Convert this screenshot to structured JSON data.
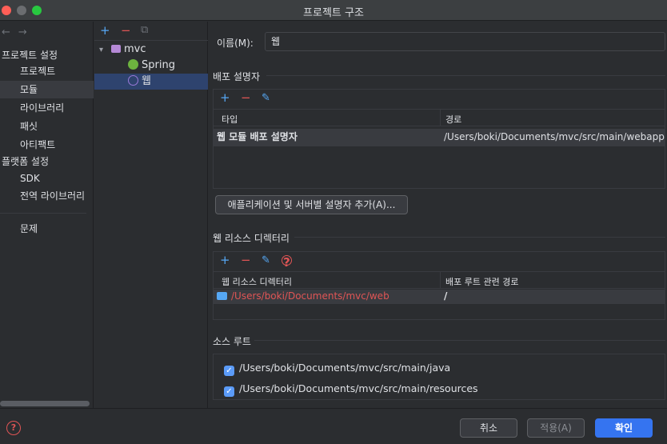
{
  "window": {
    "title": "프로젝트 구조"
  },
  "nav": {
    "back_icon": "arrow-left-icon",
    "forward_icon": "arrow-right-icon",
    "project_settings_header": "프로젝트 설정",
    "items_project": [
      "프로젝트",
      "모듈",
      "라이브러리",
      "패싯",
      "아티팩트"
    ],
    "platform_settings_header": "플랫폼 설정",
    "items_platform": [
      "SDK",
      "전역 라이브러리"
    ],
    "problems": "문제",
    "selected": "모듈"
  },
  "tree": {
    "root": "mvc",
    "children": [
      "Spring",
      "웹"
    ],
    "selected": "웹"
  },
  "main": {
    "name_label": "이름(M):",
    "name_value": "웹",
    "deploy_section": "배포 설명자",
    "deploy_table": {
      "headers": [
        "타입",
        "경로"
      ],
      "rows": [
        {
          "type": "웹 모듈 배포 설명자",
          "path": "/Users/boki/Documents/mvc/src/main/webapp/WEB-INF/web.xml"
        }
      ]
    },
    "add_server_descriptor_button": "애플리케이션 및 서버별 설명자 추가(A)...",
    "web_resource_section": "웹 리소스 디렉터리",
    "web_resource_table": {
      "headers": [
        "웹 리소스 디렉터리",
        "배포 루트 관련 경로"
      ],
      "rows": [
        {
          "dir": "/Users/boki/Documents/mvc/web",
          "rel": "/"
        }
      ]
    },
    "source_roots_section": "소스 루트",
    "source_roots": [
      {
        "path": "/Users/boki/Documents/mvc/src/main/java",
        "checked": true
      },
      {
        "path": "/Users/boki/Documents/mvc/src/main/resources",
        "checked": true
      }
    ]
  },
  "footer": {
    "cancel": "취소",
    "apply": "적용(A)",
    "ok": "확인"
  },
  "colors": {
    "accent": "#3574f0",
    "error_path": "#e05555",
    "selection": "#2e436e"
  }
}
